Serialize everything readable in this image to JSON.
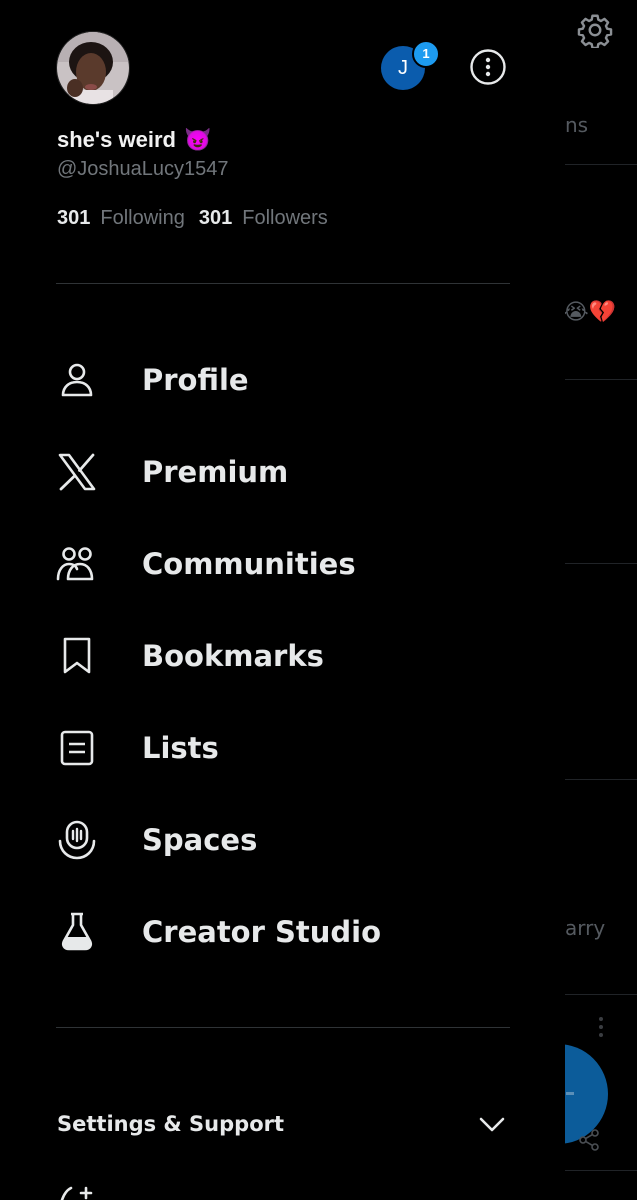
{
  "background": {
    "tab_fragment": "ns",
    "emoji_fragment": "😭💔",
    "text_fragment": "arry",
    "colors": {
      "background": "#000000",
      "fab": "#0c5c9a",
      "separator": "#202327"
    },
    "icons": [
      "gear-icon",
      "share-icon",
      "more-vertical-icon"
    ]
  },
  "header": {
    "account_initial": "J",
    "account_badge_count": "1",
    "display_name": "she's weird",
    "display_name_emoji": "😈",
    "handle": "@JoshuaLucy1547",
    "following_count": "301",
    "following_label": "Following",
    "followers_count": "301",
    "followers_label": "Followers"
  },
  "menu": {
    "items": [
      {
        "label": "Profile",
        "icon": "person-icon"
      },
      {
        "label": "Premium",
        "icon": "x-logo-icon"
      },
      {
        "label": "Communities",
        "icon": "communities-icon"
      },
      {
        "label": "Bookmarks",
        "icon": "bookmark-icon"
      },
      {
        "label": "Lists",
        "icon": "list-icon"
      },
      {
        "label": "Spaces",
        "icon": "spaces-icon"
      },
      {
        "label": "Creator Studio",
        "icon": "flask-icon"
      }
    ]
  },
  "settings": {
    "label": "Settings & Support",
    "icon": "chevron-down-icon"
  },
  "colors": {
    "accent": "#1d9bf0",
    "account_circle": "#0b5cad",
    "text_primary": "#e7e9ea",
    "text_secondary": "#71767b",
    "divider": "#2f3336"
  }
}
